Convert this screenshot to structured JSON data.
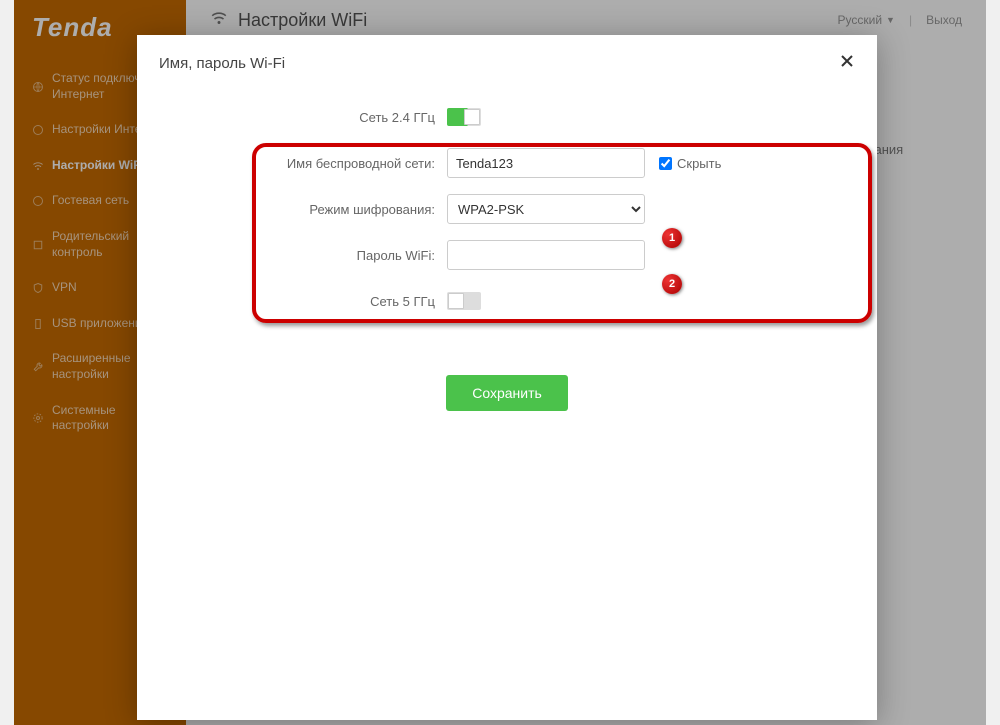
{
  "brand": "Tenda",
  "topbar": {
    "title": "Настройки WiFi",
    "language": "Русский",
    "logout": "Выход"
  },
  "sidebar": {
    "items": [
      {
        "label": "Статус подключения Интернет"
      },
      {
        "label": "Настройки Интернет"
      },
      {
        "label": "Настройки WiFi"
      },
      {
        "label": "Гостевая сеть"
      },
      {
        "label": "Родительский контроль"
      },
      {
        "label": "VPN"
      },
      {
        "label": "USB приложения"
      },
      {
        "label": "Расширенные настройки"
      },
      {
        "label": "Системные настройки"
      }
    ]
  },
  "page_fragment": "скания",
  "modal": {
    "title": "Имя, пароль Wi-Fi",
    "labels": {
      "band24": "Сеть 2.4 ГГц",
      "ssid": "Имя беспроводной сети:",
      "encryption": "Режим шифрования:",
      "password": "Пароль WiFi:",
      "band5": "Сеть 5 ГГц",
      "hide": "Скрыть"
    },
    "values": {
      "ssid": "Tenda123",
      "encryption": "WPA2-PSK",
      "password": ""
    },
    "save": "Сохранить"
  },
  "callouts": {
    "one": "1",
    "two": "2"
  }
}
